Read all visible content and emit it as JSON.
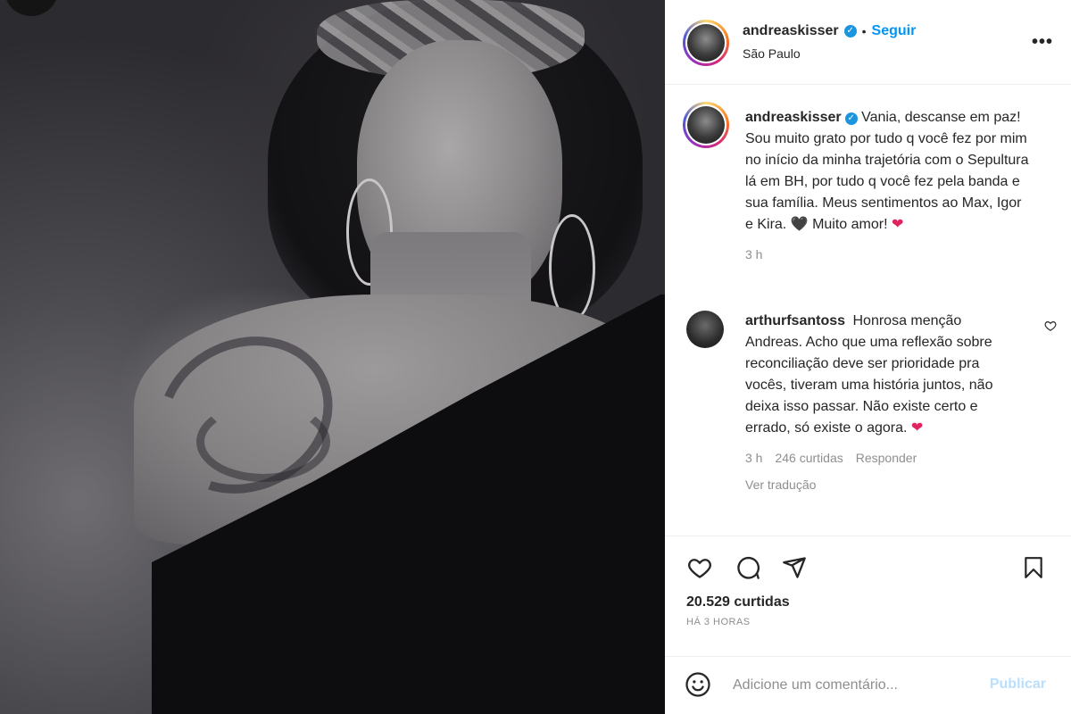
{
  "post": {
    "author": "andreaskisser",
    "follow_label": "Seguir",
    "separator": "•",
    "location": "São Paulo",
    "more_icon": "more-horizontal-icon",
    "more_label": "•••"
  },
  "caption": {
    "author": "andreaskisser",
    "text_before_black_heart": "Vania, descanse em paz! Sou muito grato por tudo q você fez por mim no início da minha trajetória com o Sepultura lá em BH, por tudo q você fez pela banda e sua família. Meus sentimentos ao Max, Igor e Kira.",
    "text_after_black_heart": "Muito amor!",
    "black_heart": "🖤",
    "red_heart": "❤",
    "time": "3 h"
  },
  "comments": [
    {
      "author": "arthurfsantoss",
      "text": "Honrosa menção Andreas. Acho que uma reflexão sobre reconciliação deve ser prioridade pra vocês, tiveram uma história juntos, não deixa isso passar. Não existe certo e errado, só existe o agora.",
      "emoji": "❤",
      "time": "3 h",
      "likes": "246 curtidas",
      "reply_label": "Responder",
      "translate_label": "Ver tradução"
    }
  ],
  "actions": {
    "likes_count": "20.529 curtidas",
    "time_ago": "HÁ 3 HORAS"
  },
  "add_comment": {
    "placeholder": "Adicione um comentário...",
    "publish_label": "Publicar"
  },
  "colors": {
    "accent": "#0095f6",
    "verified": "#1b95e0",
    "publish_disabled": "#b9dffc",
    "muted_text": "#8e8e8e",
    "heart": "#e0245e"
  }
}
